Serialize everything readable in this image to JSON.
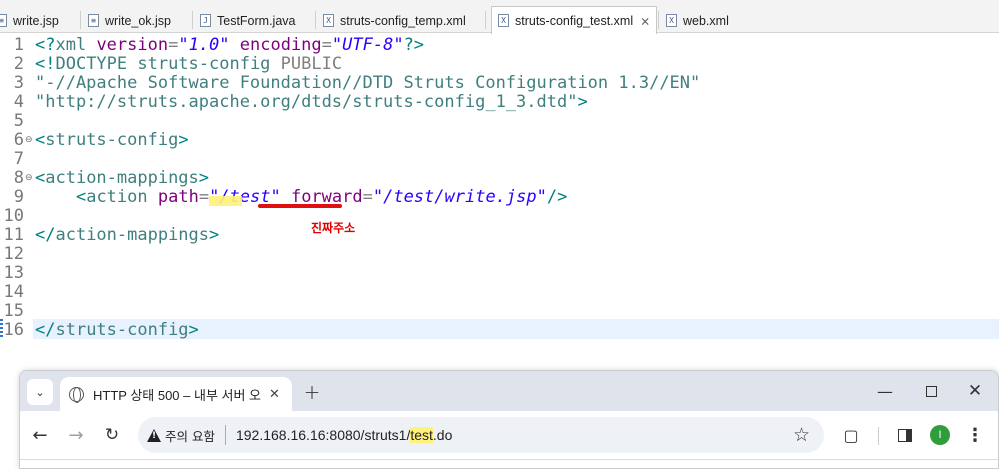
{
  "editor_tabs": [
    {
      "name": "write.jsp",
      "type": "jsp"
    },
    {
      "name": "write_ok.jsp",
      "type": "jsp"
    },
    {
      "name": "TestForm.java",
      "type": "java"
    },
    {
      "name": "struts-config_temp.xml",
      "type": "xml"
    },
    {
      "name": "struts-config_test.xml",
      "type": "xml",
      "active": true
    },
    {
      "name": "web.xml",
      "type": "xml"
    }
  ],
  "tab_icons": {
    "jsp": "file-icon",
    "java": "java-file-icon",
    "xml": "xml-file-icon"
  },
  "tab_glyphs": {
    "jsp": "≡",
    "java": "J",
    "xml": "X"
  },
  "editor": {
    "line_numbers": [
      "1",
      "2",
      "3",
      "4",
      "5",
      "6",
      "7",
      "8",
      "9",
      "10",
      "11",
      "12",
      "13",
      "14",
      "15",
      "16"
    ],
    "fold_markers": [
      "6",
      "8"
    ],
    "lines": [
      {
        "n": "1",
        "segs": [
          [
            "tg",
            "<?"
          ],
          [
            "el",
            "xml"
          ],
          [
            "at",
            " version"
          ],
          [
            "",
            ""
          ],
          [
            "dk",
            "="
          ],
          [
            "st",
            "\"1.0\""
          ],
          [
            "at",
            " encoding"
          ],
          [
            "dk",
            "="
          ],
          [
            "st",
            "\"UTF-8\""
          ],
          [
            "tg",
            "?>"
          ]
        ]
      },
      {
        "n": "2",
        "segs": [
          [
            "tg",
            "<!"
          ],
          [
            "el",
            "DOCTYPE struts-config"
          ],
          [
            "dk",
            " PUBLIC"
          ]
        ]
      },
      {
        "n": "3",
        "segs": [
          [
            "dt",
            "\"-//Apache Software Foundation//DTD Struts Configuration 1.3//EN\""
          ]
        ]
      },
      {
        "n": "4",
        "segs": [
          [
            "dt",
            "\"http://struts.apache.org/dtds/struts-config_1_3.dtd\""
          ],
          [
            "tg",
            ">"
          ]
        ]
      },
      {
        "n": "5",
        "segs": []
      },
      {
        "n": "6",
        "segs": [
          [
            "tg",
            "<"
          ],
          [
            "el",
            "struts-config"
          ],
          [
            "tg",
            ">"
          ]
        ]
      },
      {
        "n": "7",
        "segs": []
      },
      {
        "n": "8",
        "segs": [
          [
            "tg",
            "<"
          ],
          [
            "el",
            "action-mappings"
          ],
          [
            "tg",
            ">"
          ]
        ]
      },
      {
        "n": "9",
        "segs": [
          [
            "",
            "    "
          ],
          [
            "tg",
            "<"
          ],
          [
            "el",
            "action"
          ],
          [
            "at",
            " path"
          ],
          [
            "dk",
            "="
          ],
          [
            "st",
            "\"/test\""
          ],
          [
            "at",
            " forward"
          ],
          [
            "dk",
            "="
          ],
          [
            "st",
            "\"/test/write.jsp\""
          ],
          [
            "tg",
            "/>"
          ]
        ]
      },
      {
        "n": "10",
        "segs": []
      },
      {
        "n": "11",
        "segs": [
          [
            "tg",
            "</"
          ],
          [
            "el",
            "action-mappings"
          ],
          [
            "tg",
            ">"
          ]
        ]
      },
      {
        "n": "12",
        "segs": []
      },
      {
        "n": "13",
        "segs": []
      },
      {
        "n": "14",
        "segs": []
      },
      {
        "n": "15",
        "segs": []
      },
      {
        "n": "16",
        "segs": [
          [
            "tg",
            "</"
          ],
          [
            "el",
            "struts-config"
          ],
          [
            "tg",
            ">"
          ]
        ]
      }
    ]
  },
  "annotation": {
    "note": "진짜주소",
    "color": "#e00000"
  },
  "browser": {
    "tab_title": "HTTP 상태 500 – 내부 서버 오",
    "new_tab": "+",
    "security_label": "주의 요함",
    "url_prefix": "192.168.16.16:8080/struts1/",
    "url_highlight": "test",
    "url_suffix": ".do",
    "profile_initial": "I",
    "profile_color": "#2e9d3a"
  }
}
